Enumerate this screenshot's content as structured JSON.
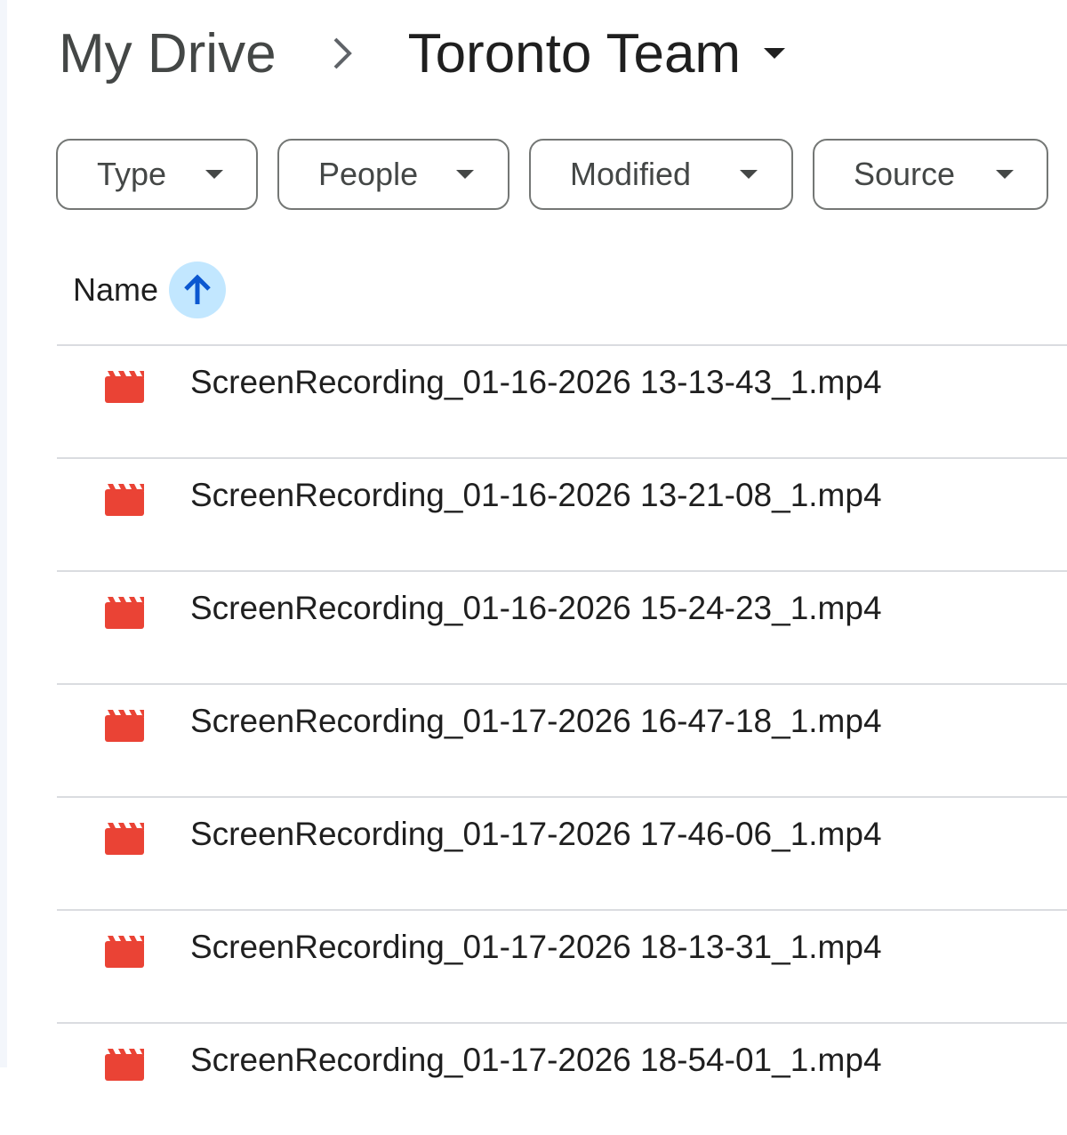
{
  "breadcrumb": {
    "root": "My Drive",
    "current": "Toronto Team"
  },
  "filters": [
    {
      "label": "Type"
    },
    {
      "label": "People"
    },
    {
      "label": "Modified"
    },
    {
      "label": "Source"
    }
  ],
  "list_header": {
    "name_label": "Name",
    "sort_direction": "ascending"
  },
  "files": [
    {
      "name": "ScreenRecording_01-16-2026 13-13-43_1.mp4",
      "icon": "video-file-icon"
    },
    {
      "name": "ScreenRecording_01-16-2026 13-21-08_1.mp4",
      "icon": "video-file-icon"
    },
    {
      "name": "ScreenRecording_01-16-2026 15-24-23_1.mp4",
      "icon": "video-file-icon"
    },
    {
      "name": "ScreenRecording_01-17-2026 16-47-18_1.mp4",
      "icon": "video-file-icon"
    },
    {
      "name": "ScreenRecording_01-17-2026 17-46-06_1.mp4",
      "icon": "video-file-icon"
    },
    {
      "name": "ScreenRecording_01-17-2026 18-13-31_1.mp4",
      "icon": "video-file-icon"
    },
    {
      "name": "ScreenRecording_01-17-2026 18-54-01_1.mp4",
      "icon": "video-file-icon"
    }
  ],
  "colors": {
    "video_icon": "#ea4335",
    "sort_button_bg": "#c2e7ff",
    "sort_arrow": "#0b57d0",
    "divider": "#dadce0"
  }
}
